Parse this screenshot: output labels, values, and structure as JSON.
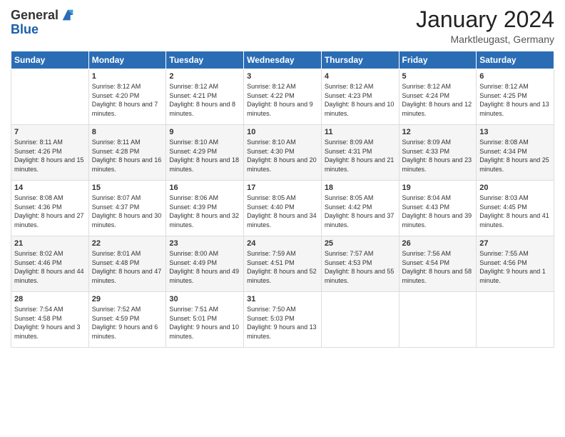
{
  "logo": {
    "general": "General",
    "blue": "Blue"
  },
  "title": "January 2024",
  "subtitle": "Marktleugast, Germany",
  "headers": [
    "Sunday",
    "Monday",
    "Tuesday",
    "Wednesday",
    "Thursday",
    "Friday",
    "Saturday"
  ],
  "weeks": [
    [
      {
        "day": "",
        "sunrise": "",
        "sunset": "",
        "daylight": ""
      },
      {
        "day": "1",
        "sunrise": "Sunrise: 8:12 AM",
        "sunset": "Sunset: 4:20 PM",
        "daylight": "Daylight: 8 hours and 7 minutes."
      },
      {
        "day": "2",
        "sunrise": "Sunrise: 8:12 AM",
        "sunset": "Sunset: 4:21 PM",
        "daylight": "Daylight: 8 hours and 8 minutes."
      },
      {
        "day": "3",
        "sunrise": "Sunrise: 8:12 AM",
        "sunset": "Sunset: 4:22 PM",
        "daylight": "Daylight: 8 hours and 9 minutes."
      },
      {
        "day": "4",
        "sunrise": "Sunrise: 8:12 AM",
        "sunset": "Sunset: 4:23 PM",
        "daylight": "Daylight: 8 hours and 10 minutes."
      },
      {
        "day": "5",
        "sunrise": "Sunrise: 8:12 AM",
        "sunset": "Sunset: 4:24 PM",
        "daylight": "Daylight: 8 hours and 12 minutes."
      },
      {
        "day": "6",
        "sunrise": "Sunrise: 8:12 AM",
        "sunset": "Sunset: 4:25 PM",
        "daylight": "Daylight: 8 hours and 13 minutes."
      }
    ],
    [
      {
        "day": "7",
        "sunrise": "Sunrise: 8:11 AM",
        "sunset": "Sunset: 4:26 PM",
        "daylight": "Daylight: 8 hours and 15 minutes."
      },
      {
        "day": "8",
        "sunrise": "Sunrise: 8:11 AM",
        "sunset": "Sunset: 4:28 PM",
        "daylight": "Daylight: 8 hours and 16 minutes."
      },
      {
        "day": "9",
        "sunrise": "Sunrise: 8:10 AM",
        "sunset": "Sunset: 4:29 PM",
        "daylight": "Daylight: 8 hours and 18 minutes."
      },
      {
        "day": "10",
        "sunrise": "Sunrise: 8:10 AM",
        "sunset": "Sunset: 4:30 PM",
        "daylight": "Daylight: 8 hours and 20 minutes."
      },
      {
        "day": "11",
        "sunrise": "Sunrise: 8:09 AM",
        "sunset": "Sunset: 4:31 PM",
        "daylight": "Daylight: 8 hours and 21 minutes."
      },
      {
        "day": "12",
        "sunrise": "Sunrise: 8:09 AM",
        "sunset": "Sunset: 4:33 PM",
        "daylight": "Daylight: 8 hours and 23 minutes."
      },
      {
        "day": "13",
        "sunrise": "Sunrise: 8:08 AM",
        "sunset": "Sunset: 4:34 PM",
        "daylight": "Daylight: 8 hours and 25 minutes."
      }
    ],
    [
      {
        "day": "14",
        "sunrise": "Sunrise: 8:08 AM",
        "sunset": "Sunset: 4:36 PM",
        "daylight": "Daylight: 8 hours and 27 minutes."
      },
      {
        "day": "15",
        "sunrise": "Sunrise: 8:07 AM",
        "sunset": "Sunset: 4:37 PM",
        "daylight": "Daylight: 8 hours and 30 minutes."
      },
      {
        "day": "16",
        "sunrise": "Sunrise: 8:06 AM",
        "sunset": "Sunset: 4:39 PM",
        "daylight": "Daylight: 8 hours and 32 minutes."
      },
      {
        "day": "17",
        "sunrise": "Sunrise: 8:05 AM",
        "sunset": "Sunset: 4:40 PM",
        "daylight": "Daylight: 8 hours and 34 minutes."
      },
      {
        "day": "18",
        "sunrise": "Sunrise: 8:05 AM",
        "sunset": "Sunset: 4:42 PM",
        "daylight": "Daylight: 8 hours and 37 minutes."
      },
      {
        "day": "19",
        "sunrise": "Sunrise: 8:04 AM",
        "sunset": "Sunset: 4:43 PM",
        "daylight": "Daylight: 8 hours and 39 minutes."
      },
      {
        "day": "20",
        "sunrise": "Sunrise: 8:03 AM",
        "sunset": "Sunset: 4:45 PM",
        "daylight": "Daylight: 8 hours and 41 minutes."
      }
    ],
    [
      {
        "day": "21",
        "sunrise": "Sunrise: 8:02 AM",
        "sunset": "Sunset: 4:46 PM",
        "daylight": "Daylight: 8 hours and 44 minutes."
      },
      {
        "day": "22",
        "sunrise": "Sunrise: 8:01 AM",
        "sunset": "Sunset: 4:48 PM",
        "daylight": "Daylight: 8 hours and 47 minutes."
      },
      {
        "day": "23",
        "sunrise": "Sunrise: 8:00 AM",
        "sunset": "Sunset: 4:49 PM",
        "daylight": "Daylight: 8 hours and 49 minutes."
      },
      {
        "day": "24",
        "sunrise": "Sunrise: 7:59 AM",
        "sunset": "Sunset: 4:51 PM",
        "daylight": "Daylight: 8 hours and 52 minutes."
      },
      {
        "day": "25",
        "sunrise": "Sunrise: 7:57 AM",
        "sunset": "Sunset: 4:53 PM",
        "daylight": "Daylight: 8 hours and 55 minutes."
      },
      {
        "day": "26",
        "sunrise": "Sunrise: 7:56 AM",
        "sunset": "Sunset: 4:54 PM",
        "daylight": "Daylight: 8 hours and 58 minutes."
      },
      {
        "day": "27",
        "sunrise": "Sunrise: 7:55 AM",
        "sunset": "Sunset: 4:56 PM",
        "daylight": "Daylight: 9 hours and 1 minute."
      }
    ],
    [
      {
        "day": "28",
        "sunrise": "Sunrise: 7:54 AM",
        "sunset": "Sunset: 4:58 PM",
        "daylight": "Daylight: 9 hours and 3 minutes."
      },
      {
        "day": "29",
        "sunrise": "Sunrise: 7:52 AM",
        "sunset": "Sunset: 4:59 PM",
        "daylight": "Daylight: 9 hours and 6 minutes."
      },
      {
        "day": "30",
        "sunrise": "Sunrise: 7:51 AM",
        "sunset": "Sunset: 5:01 PM",
        "daylight": "Daylight: 9 hours and 10 minutes."
      },
      {
        "day": "31",
        "sunrise": "Sunrise: 7:50 AM",
        "sunset": "Sunset: 5:03 PM",
        "daylight": "Daylight: 9 hours and 13 minutes."
      },
      {
        "day": "",
        "sunrise": "",
        "sunset": "",
        "daylight": ""
      },
      {
        "day": "",
        "sunrise": "",
        "sunset": "",
        "daylight": ""
      },
      {
        "day": "",
        "sunrise": "",
        "sunset": "",
        "daylight": ""
      }
    ]
  ]
}
